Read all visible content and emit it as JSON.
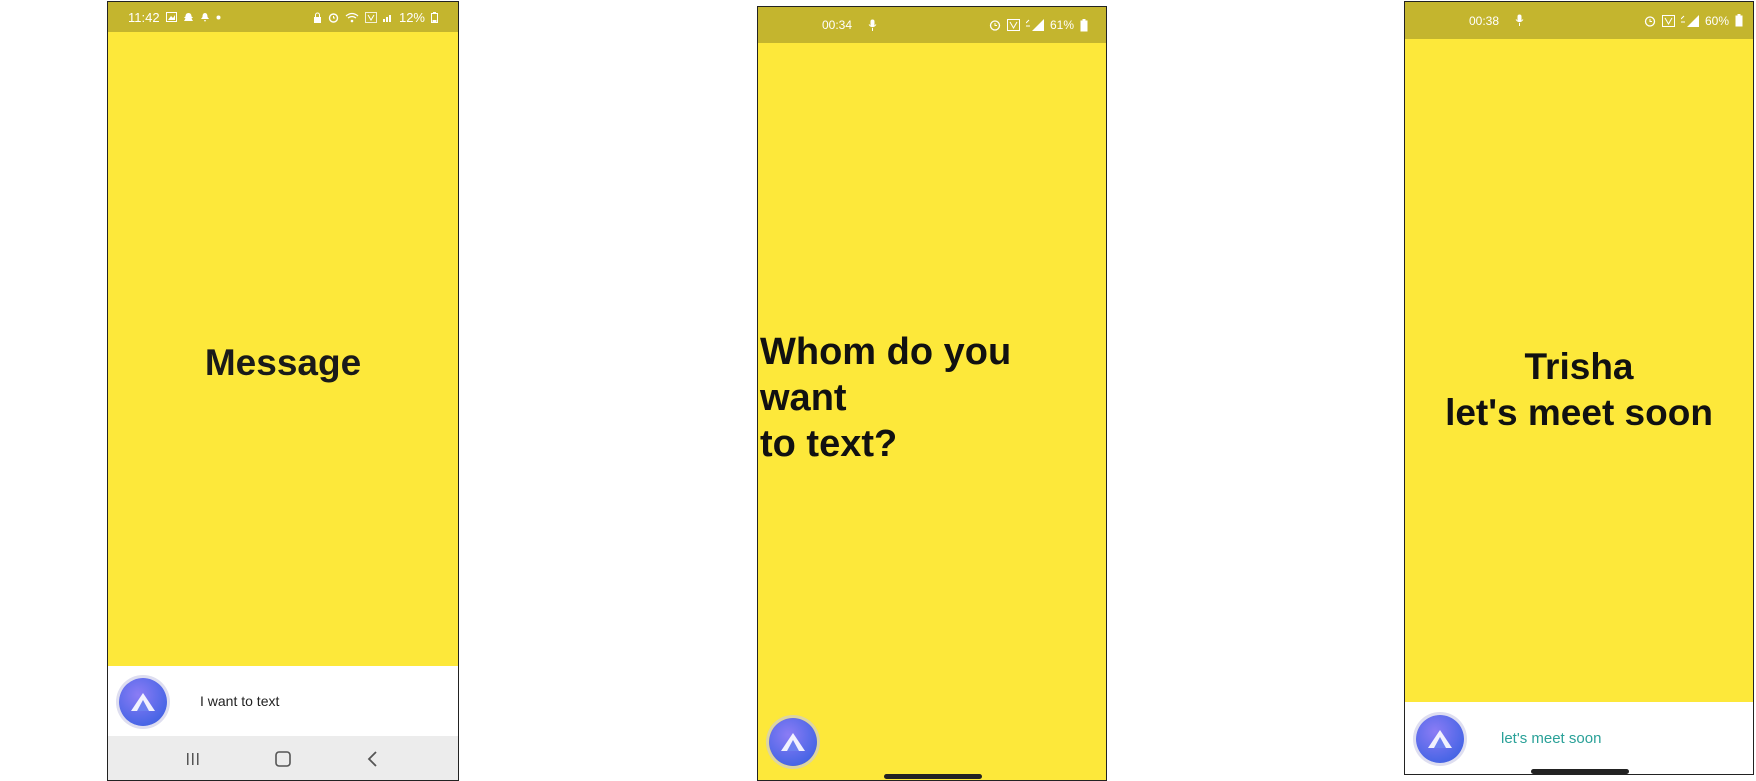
{
  "screens": [
    {
      "status": {
        "time": "11:42",
        "battery": "12%"
      },
      "main_text": "Message",
      "assistant": {
        "text": "I want to text"
      },
      "nav": {
        "recents_icon": "recents-icon",
        "home_icon": "home-icon",
        "back_icon": "back-icon"
      }
    },
    {
      "status": {
        "time": "00:34",
        "battery": "61%"
      },
      "main_text_lines": [
        "Whom do you want",
        "to text?"
      ]
    },
    {
      "status": {
        "time": "00:38",
        "battery": "60%"
      },
      "main_text_lines": [
        "Trisha",
        "let's meet soon"
      ],
      "assistant": {
        "text": "let's meet soon"
      }
    }
  ],
  "colors": {
    "background": "#fde83a",
    "status_bar": "#c4b52e",
    "assistant_accent": "#2aa198",
    "avatar": "#4a66e6"
  }
}
